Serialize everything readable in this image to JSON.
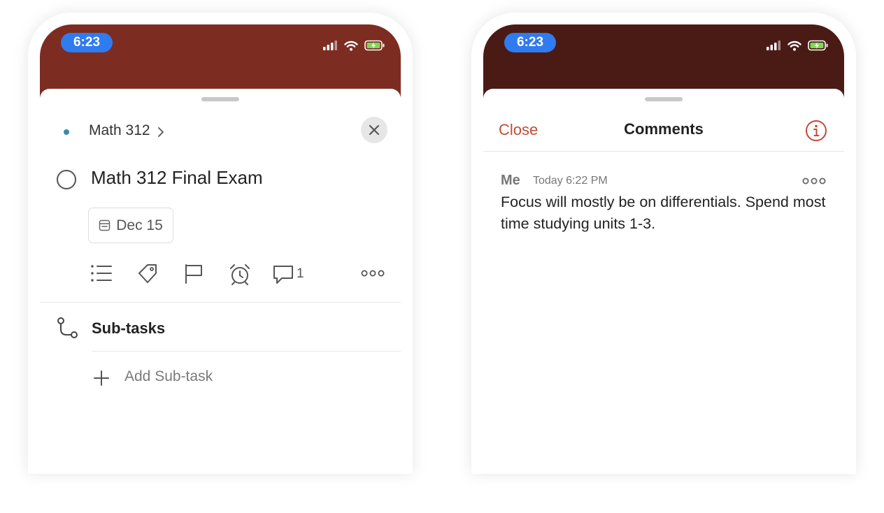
{
  "left_phone": {
    "status_time": "6:23",
    "project": "Math 312",
    "task_title": "Math 312 Final Exam",
    "due_date": "Dec 15",
    "comment_count": "1",
    "subtasks_heading": "Sub-tasks",
    "add_subtask_label": "Add Sub-task"
  },
  "right_phone": {
    "status_time": "6:23",
    "close_label": "Close",
    "title": "Comments",
    "comment": {
      "author": "Me",
      "timestamp": "Today 6:22 PM",
      "body": "Focus will mostly be on differentials. Spend most time studying units 1-3."
    }
  },
  "colors": {
    "left_header": "#7d2c22",
    "right_header": "#4a1b15",
    "time_pill": "#2f7bf0",
    "accent_red": "#c24b38",
    "project_dot": "#3c8aa8"
  },
  "icons": [
    "signal-icon",
    "wifi-icon",
    "battery-icon",
    "chevron-right-icon",
    "close-icon",
    "calendar-icon",
    "list-icon",
    "tag-icon",
    "flag-icon",
    "alarm-icon",
    "comment-icon",
    "more-icon",
    "subtask-icon",
    "plus-icon",
    "info-icon"
  ]
}
